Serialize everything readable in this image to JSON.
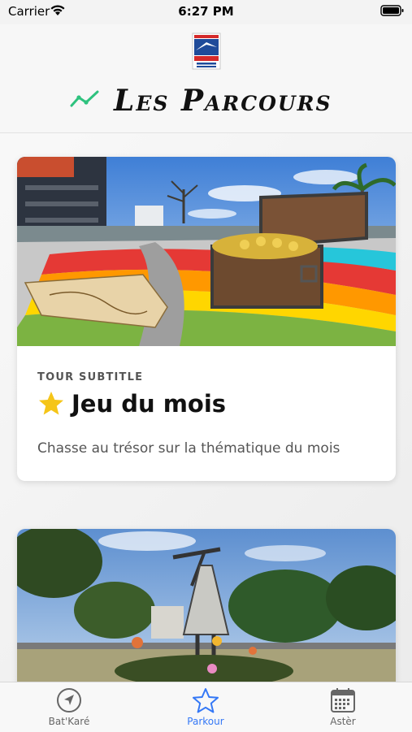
{
  "status_bar": {
    "carrier": "Carrier",
    "time": "6:27 PM"
  },
  "header": {
    "logo_icon": "saint-denis-logo",
    "title": "Les Parcours",
    "title_icon": "trend-line-icon",
    "accent": "#2ec27e"
  },
  "cards": [
    {
      "subtitle": "TOUR SUBTITLE",
      "title": "Jeu du mois",
      "title_icon": "star-icon",
      "description": "Chasse au trésor sur la thématique du mois",
      "image": "treasure-chest-map-photo"
    },
    {
      "image": "statue-park-photo"
    }
  ],
  "tabbar": {
    "active_color": "#3478f6",
    "items": [
      {
        "label": "Bat'Karé",
        "icon": "compass-arrow-icon"
      },
      {
        "label": "Parkour",
        "icon": "star-outline-icon"
      },
      {
        "label": "Astèr",
        "icon": "calendar-icon"
      }
    ]
  }
}
